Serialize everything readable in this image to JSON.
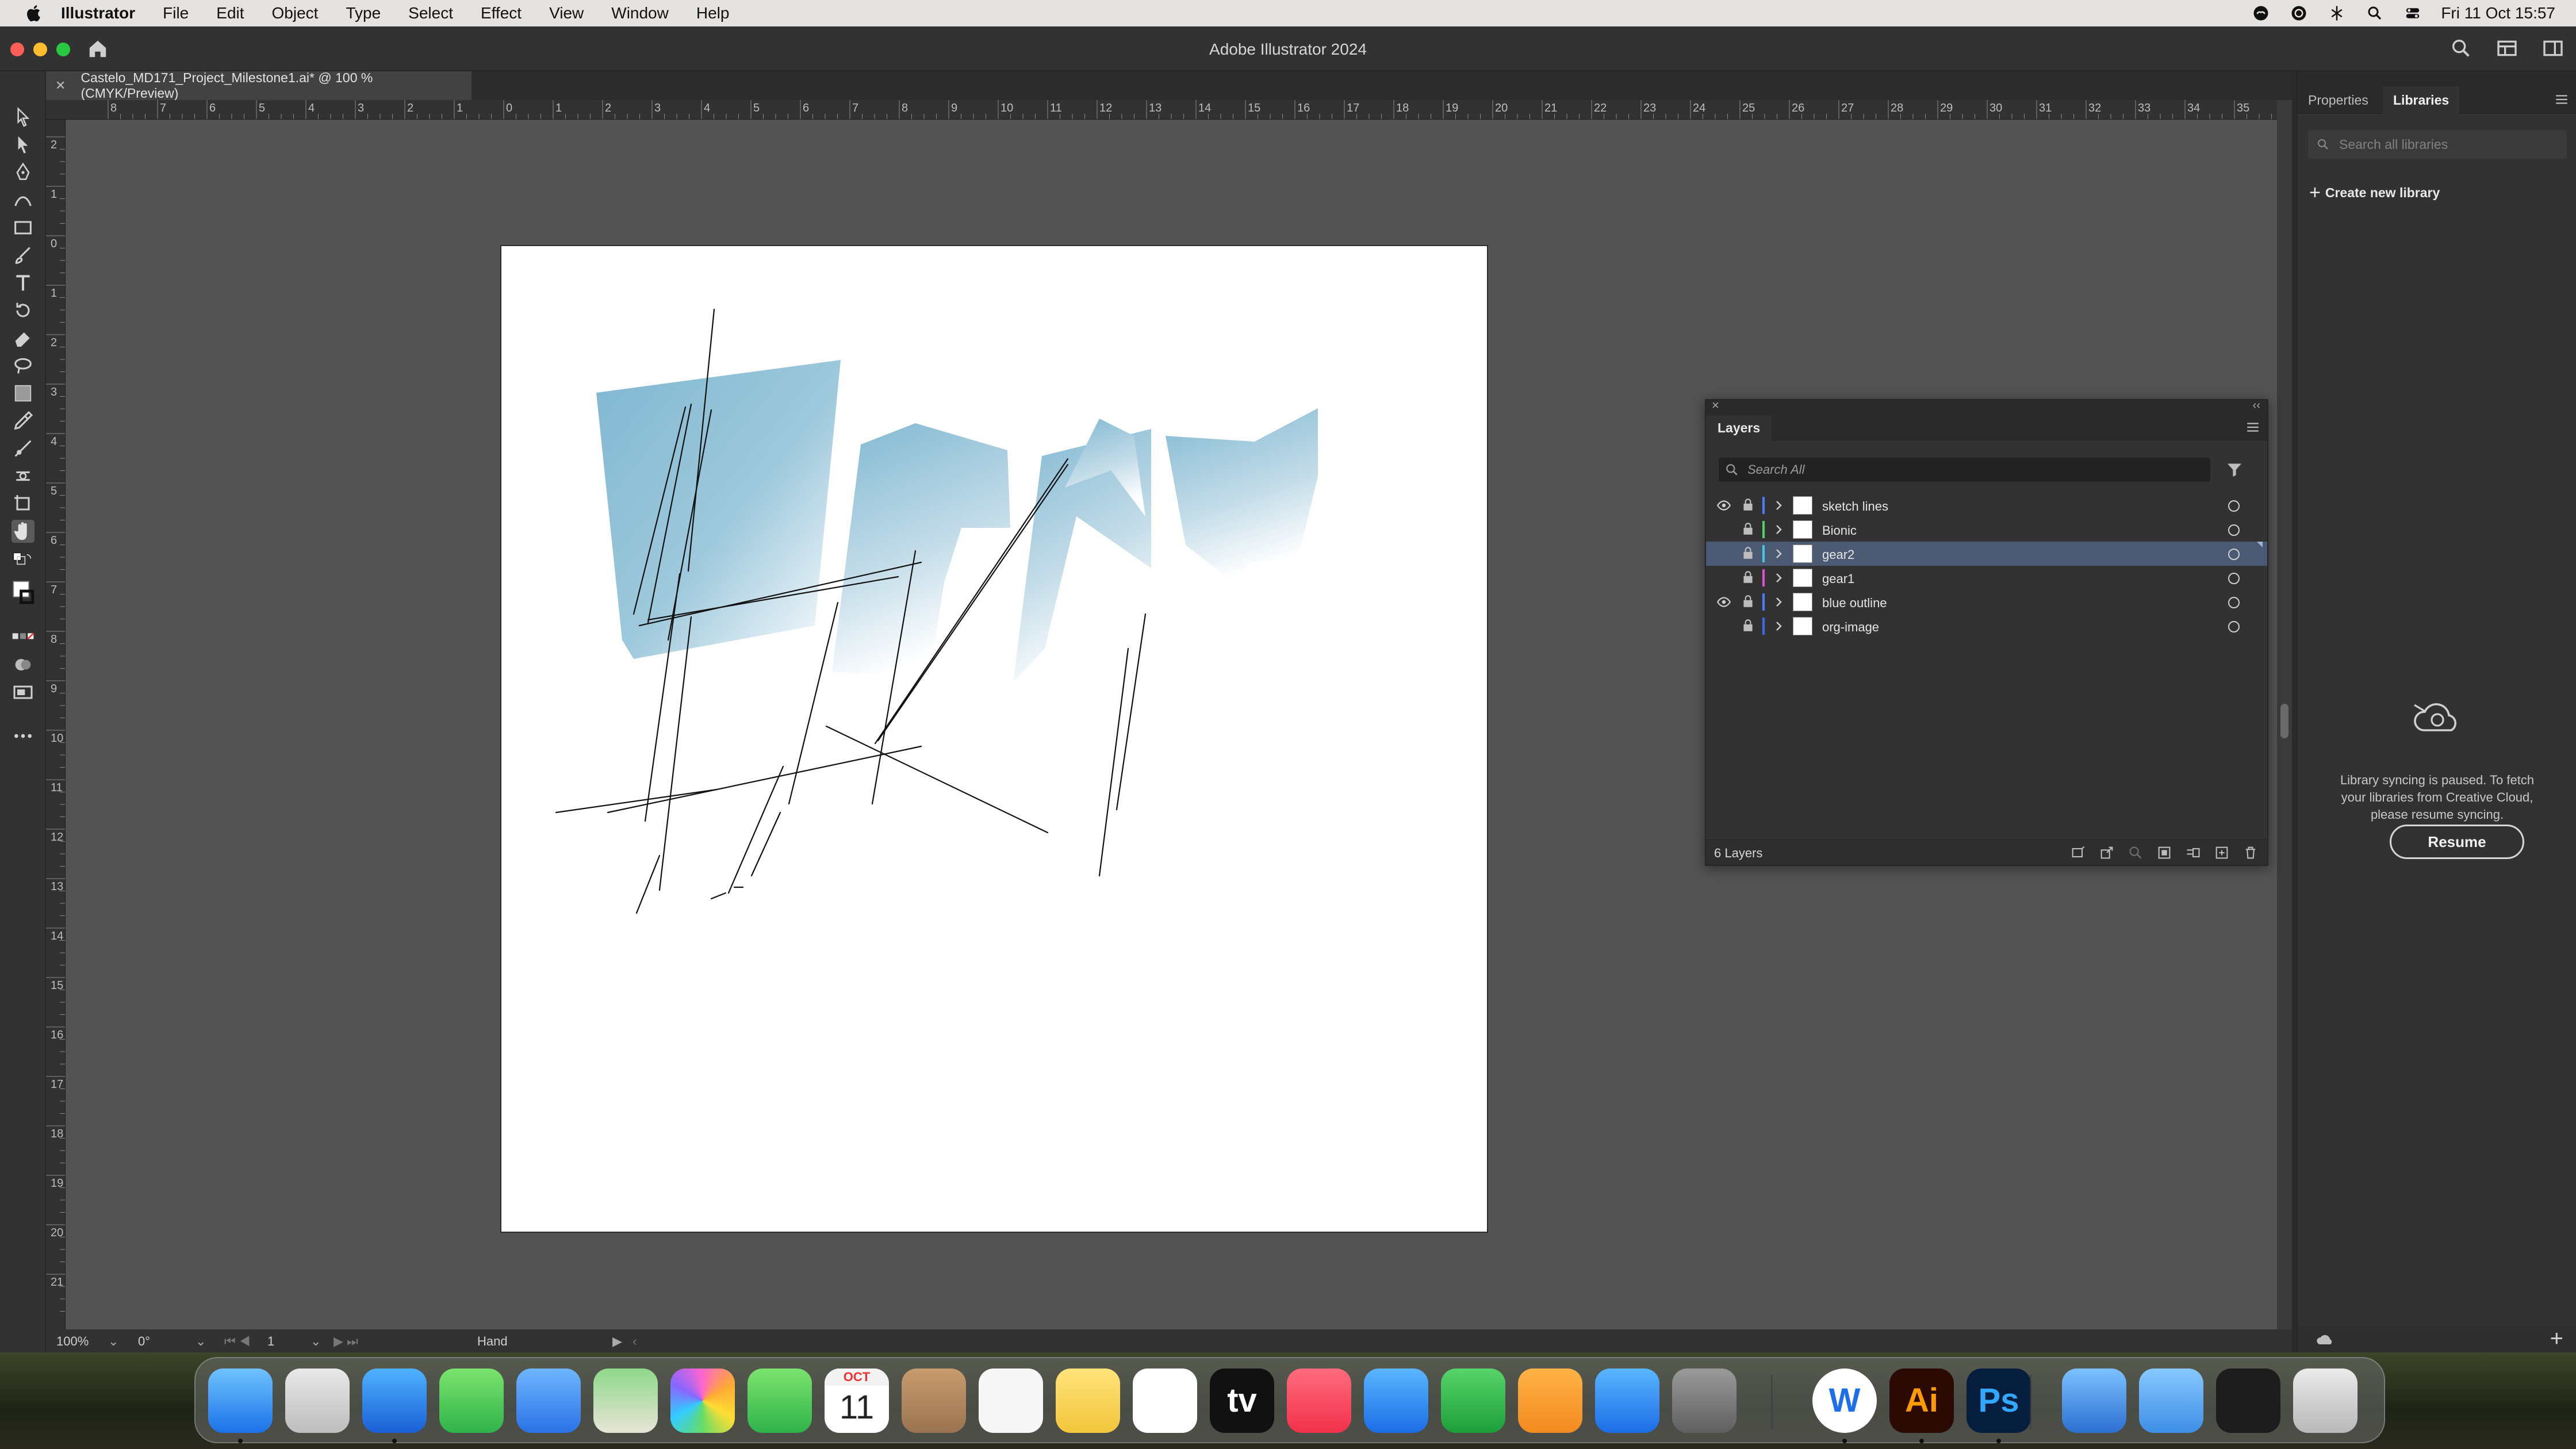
{
  "menubar": {
    "app_name": "Illustrator",
    "items": [
      "File",
      "Edit",
      "Object",
      "Type",
      "Select",
      "Effect",
      "View",
      "Window",
      "Help"
    ],
    "clock": "Fri 11 Oct  15:57"
  },
  "window": {
    "title": "Adobe Illustrator 2024"
  },
  "document_tab": {
    "label": "Castelo_MD171_Project_Milestone1.ai* @ 100 % (CMYK/Preview)"
  },
  "ruler_h_labels": [
    "8",
    "7",
    "6",
    "5",
    "4",
    "3",
    "2",
    "1",
    "0",
    "1",
    "2",
    "3",
    "4",
    "5",
    "6",
    "7",
    "8",
    "9",
    "10",
    "11",
    "12",
    "13",
    "14",
    "15",
    "16",
    "17",
    "18",
    "19",
    "20",
    "21",
    "22",
    "23",
    "24",
    "25",
    "26",
    "27",
    "28",
    "29",
    "30",
    "31",
    "32",
    "33",
    "34",
    "35"
  ],
  "ruler_v_labels": [
    "2",
    "1",
    "0",
    "1",
    "2",
    "3",
    "4",
    "5",
    "6",
    "7",
    "8",
    "9",
    "10",
    "11",
    "12",
    "13",
    "14",
    "15",
    "16",
    "17",
    "18",
    "19",
    "20",
    "21"
  ],
  "status": {
    "zoom": "100%",
    "rotation": "0°",
    "artboard": "1",
    "tool": "Hand"
  },
  "layers_panel": {
    "title": "Layers",
    "search_placeholder": "Search All",
    "layers": [
      {
        "name": "sketch lines",
        "visible": true,
        "color": "#4f7bff",
        "selected": false
      },
      {
        "name": "Bionic",
        "visible": false,
        "color": "#4fd45f",
        "selected": false
      },
      {
        "name": "gear2",
        "visible": false,
        "color": "#45c7e0",
        "selected": true
      },
      {
        "name": "gear1",
        "visible": false,
        "color": "#e04fd0",
        "selected": false
      },
      {
        "name": "blue outline",
        "visible": true,
        "color": "#4f7bff",
        "selected": false
      },
      {
        "name": "org-image",
        "visible": false,
        "color": "#3a6aee",
        "selected": false
      }
    ],
    "count_label": "6 Layers"
  },
  "right_panel": {
    "tabs": [
      "Properties",
      "Libraries"
    ],
    "active_tab": "Libraries",
    "search_placeholder": "Search all libraries",
    "create_label": "Create new library",
    "sync_message": [
      "Library syncing is paused. To fetch",
      "your libraries from Creative Cloud,",
      "please resume syncing."
    ],
    "resume_label": "Resume"
  },
  "dock": {
    "apps": [
      "Finder",
      "Launchpad",
      "Safari",
      "Messages",
      "Mail",
      "Maps",
      "Photos",
      "FaceTime",
      "Calendar",
      "Contacts",
      "Reminders",
      "Notes",
      "Freeform",
      "TV",
      "Music",
      "Keynote",
      "Numbers",
      "Pages",
      "App Store",
      "System Settings",
      "Word",
      "Illustrator",
      "Photoshop",
      "Network",
      "Downloads",
      "Screenshot",
      "Trash"
    ],
    "calendar_month": "OCT",
    "calendar_day": "11",
    "illustrator_label": "Ai",
    "photoshop_label": "Ps",
    "word_label": "W",
    "tv_label": "tv"
  },
  "colors": {
    "accent_selected_row": "#4b5a72",
    "artwork_fill": "#7fb7d1"
  }
}
